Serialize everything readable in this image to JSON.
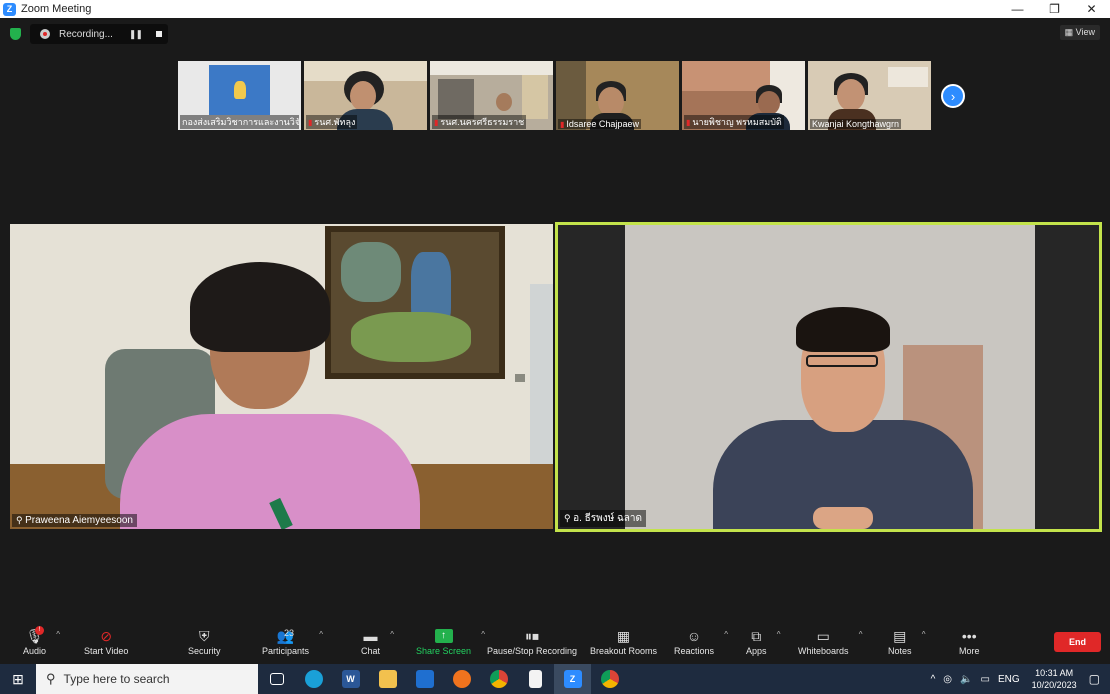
{
  "window": {
    "title": "Zoom Meeting",
    "min": "—",
    "restore": "❐",
    "close": "✕"
  },
  "recording": {
    "label": "Recording...",
    "pause": "❚❚"
  },
  "view": {
    "label": "▦ View"
  },
  "thumbnails": [
    {
      "name": "กองส่งเสริมวิชาการและงานวิจัย",
      "muted": false,
      "bg": "#e9e9e9"
    },
    {
      "name": "รนศ.พัทลุง",
      "muted": true,
      "bg": "#c9b79a"
    },
    {
      "name": "รนศ.นครศรีธรรมราช",
      "muted": true,
      "bg": "#b7ad9c"
    },
    {
      "name": "Idsaree Chajpaew",
      "muted": true,
      "bg": "#a6885a"
    },
    {
      "name": "นายพิชาญ พรหมสมบัติ",
      "muted": true,
      "bg": "#a57458"
    },
    {
      "name": "Kwanjai Kongthawgrn",
      "muted": false,
      "bg": "#d8cbb5"
    }
  ],
  "next_label": "›",
  "tiles": {
    "left": {
      "name": "Praweena Aiemyeesoon"
    },
    "right": {
      "name": "อ. ธีรพงษ์ ฉลาด"
    }
  },
  "toolbar": {
    "audio": "Audio",
    "audio_badge": "!",
    "video": "Start Video",
    "security": "Security",
    "participants": "Participants",
    "participants_count": "23",
    "chat": "Chat",
    "share": "Share Screen",
    "record": "Pause/Stop Recording",
    "breakout": "Breakout Rooms",
    "reactions": "Reactions",
    "apps": "Apps",
    "whiteboards": "Whiteboards",
    "notes": "Notes",
    "more": "More",
    "end": "End"
  },
  "taskbar": {
    "search_placeholder": "Type here to search",
    "lang": "ENG",
    "time": "10:31 AM",
    "date": "10/20/2023"
  },
  "colors": {
    "accent": "#2d8cff",
    "active_speaker": "#c3e34b",
    "end": "#e02828",
    "share": "#23b14d"
  }
}
